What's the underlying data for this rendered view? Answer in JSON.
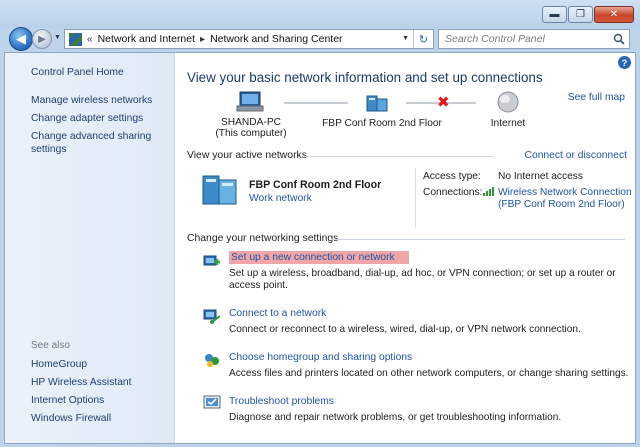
{
  "window": {
    "controls": {
      "minimize": "▬",
      "maximize": "❐",
      "close": "✕"
    }
  },
  "nav": {
    "back_glyph": "◀",
    "forward_glyph": "▶",
    "breadcrumb_prefix": "«",
    "breadcrumb": [
      "Network and Internet",
      "Network and Sharing Center"
    ],
    "search_placeholder": "Search Control Panel"
  },
  "sidebar": {
    "home": "Control Panel Home",
    "items": [
      "Manage wireless networks",
      "Change adapter settings",
      "Change advanced sharing settings"
    ],
    "see_also_title": "See also",
    "see_also": [
      "HomeGroup",
      "HP Wireless Assistant",
      "Internet Options",
      "Windows Firewall"
    ]
  },
  "main": {
    "title": "View your basic network information and set up connections",
    "see_full_map": "See full map",
    "map": {
      "computer": "SHANDA-PC",
      "computer_sub": "(This computer)",
      "network": "FBP Conf Room 2nd Floor",
      "internet": "Internet"
    },
    "active_header": "View your active networks",
    "connect_disconnect": "Connect or disconnect",
    "active_network": {
      "name": "FBP Conf Room 2nd Floor",
      "type": "Work network",
      "access_label": "Access type:",
      "access_value": "No Internet access",
      "connections_label": "Connections:",
      "connection_line1": "Wireless Network Connection",
      "connection_line2": "(FBP Conf Room 2nd Floor)"
    },
    "settings_header": "Change your networking settings",
    "tasks": [
      {
        "link": "Set up a new connection or network",
        "desc": "Set up a wireless, broadband, dial-up, ad hoc, or VPN connection; or set up a router or access point."
      },
      {
        "link": "Connect to a network",
        "desc": "Connect or reconnect to a wireless, wired, dial-up, or VPN network connection."
      },
      {
        "link": "Choose homegroup and sharing options",
        "desc": "Access files and printers located on other network computers, or change sharing settings."
      },
      {
        "link": "Troubleshoot problems",
        "desc": "Diagnose and repair network problems, or get troubleshooting information."
      }
    ]
  },
  "colors": {
    "link": "#1f55a3",
    "highlight": "#f0a6a8",
    "title": "#1c3a6b"
  }
}
